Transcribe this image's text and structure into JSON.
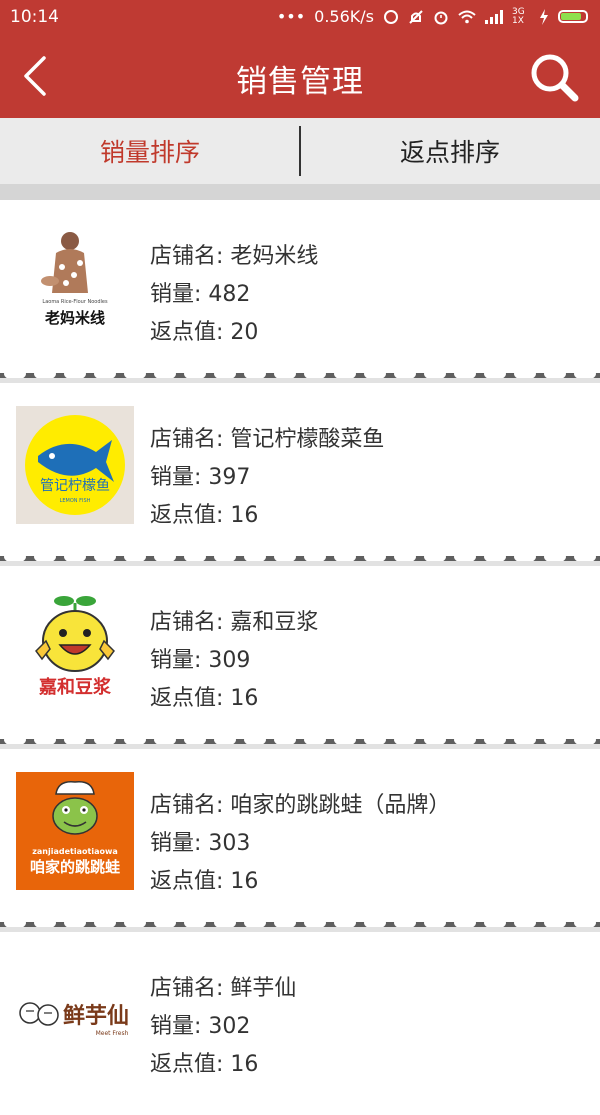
{
  "status": {
    "time": "10:14",
    "dots": "•••",
    "speed": "0.56K/s",
    "network": "3G 1X",
    "battery_level": 0.85
  },
  "header": {
    "title": "销售管理"
  },
  "tabs": [
    {
      "label": "销量排序",
      "active": true
    },
    {
      "label": "返点排序",
      "active": false
    }
  ],
  "field_labels": {
    "name": "店铺名: ",
    "sales": "销量: ",
    "rebate": "返点值: "
  },
  "stores": [
    {
      "name": "老妈米线",
      "sales": "482",
      "rebate": "20",
      "logo_text": "老妈米线",
      "logo_subtext": "Laoma Rice-Flour Noodles"
    },
    {
      "name": "管记柠檬酸菜鱼",
      "sales": "397",
      "rebate": "16",
      "logo_text": "管记柠檬鱼",
      "logo_subtext": "LEMON FISH"
    },
    {
      "name": "嘉和豆浆",
      "sales": "309",
      "rebate": "16",
      "logo_text": "嘉和豆浆"
    },
    {
      "name": "咱家的跳跳蛙（品牌）",
      "sales": "303",
      "rebate": "16",
      "logo_text": "咱家的跳跳蛙",
      "logo_subtext": "zanjiadetiaotiaowa"
    },
    {
      "name": "鲜芋仙",
      "sales": "302",
      "rebate": "16",
      "logo_text": "鲜芋仙",
      "logo_subtext": "Meet Fresh"
    }
  ],
  "colors": {
    "brand_red": "#bf3a33",
    "tab_active": "#c0392b",
    "tab_bg": "#ebebeb",
    "divider_gray": "#d5d5d5"
  }
}
